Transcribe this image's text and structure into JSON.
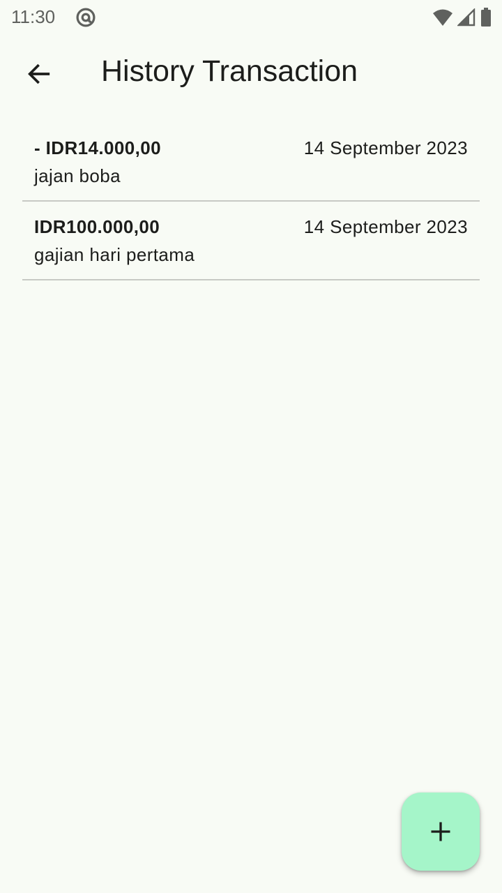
{
  "status_bar": {
    "time": "11:30"
  },
  "app_bar": {
    "title": "History Transaction"
  },
  "transactions": [
    {
      "amount": "- IDR14.000,00",
      "description": "jajan boba",
      "date": "14 September 2023"
    },
    {
      "amount": "IDR100.000,00",
      "description": "gajian hari pertama",
      "date": "14 September 2023"
    }
  ],
  "icons": {
    "status_left": "at-sign-icon",
    "status_right": [
      "wifi-icon",
      "cellular-signal-icon",
      "battery-icon"
    ],
    "back": "arrow-back-icon",
    "fab": "add-icon"
  },
  "colors": {
    "background": "#f8fbf5",
    "fab": "#a5f5c9",
    "divider": "#c7c9c4",
    "text": "#1c1d1b"
  }
}
